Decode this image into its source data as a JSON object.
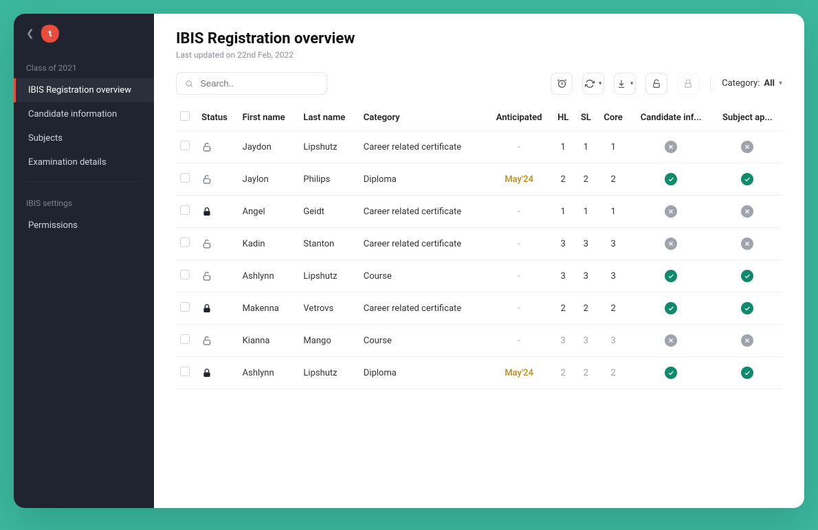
{
  "sidebar": {
    "section1_label": "Class of 2021",
    "items": [
      {
        "label": "IBIS Registration overview",
        "active": true
      },
      {
        "label": "Candidate information",
        "active": false
      },
      {
        "label": "Subjects",
        "active": false
      },
      {
        "label": "Examination details",
        "active": false
      }
    ],
    "section2_label": "IBIS settings",
    "items2": [
      {
        "label": "Permissions"
      }
    ]
  },
  "header": {
    "title": "IBIS Registration overview",
    "last_updated": "Last updated on 22nd Feb, 2022"
  },
  "toolbar": {
    "search_placeholder": "Search..",
    "category_label": "Category:",
    "category_value": "All"
  },
  "table": {
    "columns": [
      "Status",
      "First name",
      "Last name",
      "Category",
      "Anticipated",
      "HL",
      "SL",
      "Core",
      "Candidate inf...",
      "Subject ap..."
    ],
    "rows": [
      {
        "locked": false,
        "first": "Jaydon",
        "last": "Lipshutz",
        "category": "Career related certificate",
        "anticipated": "-",
        "hl": "1",
        "sl": "1",
        "core": "1",
        "cand": "no",
        "subj": "no",
        "dim": false
      },
      {
        "locked": false,
        "first": "Jaylon",
        "last": "Philips",
        "category": "Diploma",
        "anticipated": "May'24",
        "hl": "2",
        "sl": "2",
        "core": "2",
        "cand": "ok",
        "subj": "ok",
        "dim": false
      },
      {
        "locked": true,
        "first": "Angel",
        "last": "Geidt",
        "category": "Career related certificate",
        "anticipated": "-",
        "hl": "1",
        "sl": "1",
        "core": "1",
        "cand": "no",
        "subj": "no",
        "dim": false
      },
      {
        "locked": false,
        "first": "Kadin",
        "last": "Stanton",
        "category": "Career related certificate",
        "anticipated": "-",
        "hl": "3",
        "sl": "3",
        "core": "3",
        "cand": "no",
        "subj": "no",
        "dim": false
      },
      {
        "locked": false,
        "first": "Ashlynn",
        "last": "Lipshutz",
        "category": "Course",
        "anticipated": "-",
        "hl": "3",
        "sl": "3",
        "core": "3",
        "cand": "ok",
        "subj": "ok",
        "dim": false
      },
      {
        "locked": true,
        "first": "Makenna",
        "last": "Vetrovs",
        "category": "Career related certificate",
        "anticipated": "-",
        "hl": "2",
        "sl": "2",
        "core": "2",
        "cand": "ok",
        "subj": "ok",
        "dim": false
      },
      {
        "locked": false,
        "first": "Kianna",
        "last": "Mango",
        "category": "Course",
        "anticipated": "-",
        "hl": "3",
        "sl": "3",
        "core": "3",
        "cand": "no",
        "subj": "no",
        "dim": true
      },
      {
        "locked": true,
        "first": "Ashlynn",
        "last": "Lipshutz",
        "category": "Diploma",
        "anticipated": "May'24",
        "hl": "2",
        "sl": "2",
        "core": "2",
        "cand": "ok",
        "subj": "ok",
        "dim": true
      }
    ]
  }
}
